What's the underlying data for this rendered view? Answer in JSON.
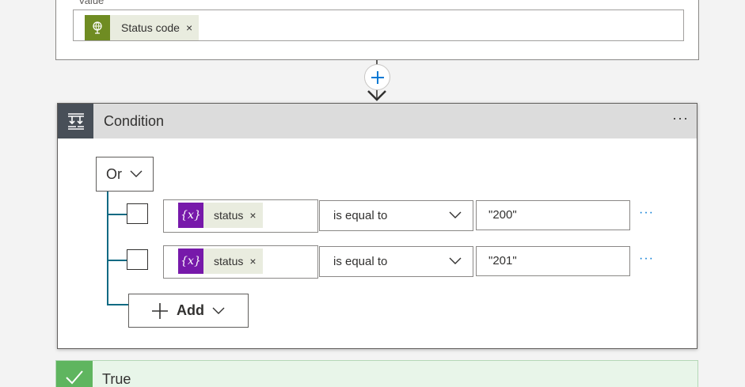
{
  "previous_action": {
    "field_label": "Value",
    "token": {
      "label": "Status code",
      "remove": "×",
      "icon": "globe-icon",
      "color": "#6f8c22"
    }
  },
  "connector": {
    "insert_icon": "plus-icon"
  },
  "condition": {
    "title": "Condition",
    "menu": "···",
    "group_operator": "Or",
    "rows": [
      {
        "operand": "status",
        "operand_icon": "variable-icon",
        "remove": "×",
        "operator": "is equal to",
        "value": "\"200\"",
        "more": "···"
      },
      {
        "operand": "status",
        "operand_icon": "variable-icon",
        "remove": "×",
        "operator": "is equal to",
        "value": "\"201\"",
        "more": "···"
      }
    ],
    "add_label": "Add"
  },
  "true_branch": {
    "label": "True",
    "icon": "checkmark-icon",
    "color": "#5fb55f"
  },
  "colors": {
    "accent": "#0078d4",
    "variable": "#7719aa",
    "tree": "#0f6a83",
    "header": "#484f58"
  }
}
